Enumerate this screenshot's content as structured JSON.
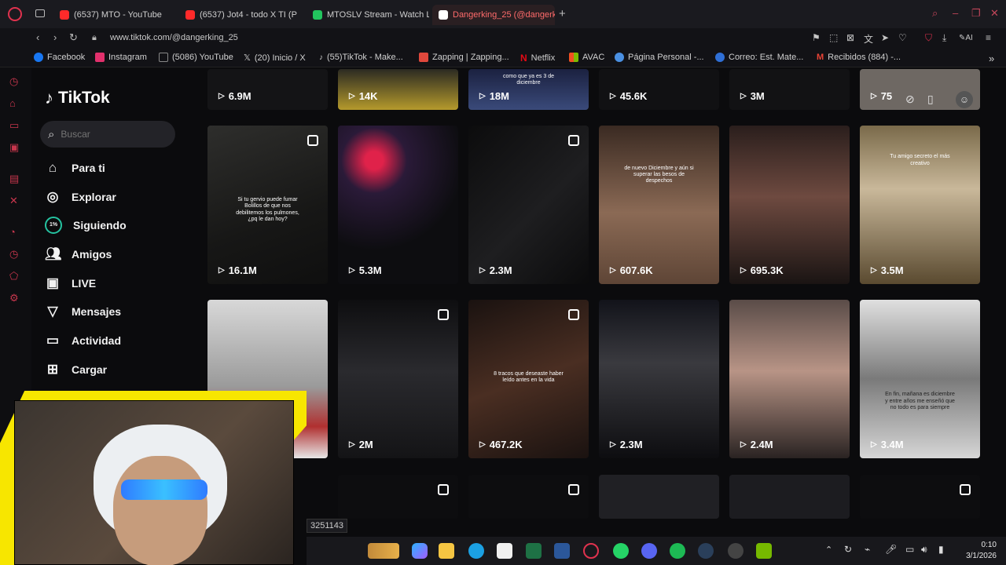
{
  "browser": {
    "tabs": [
      {
        "title": "(6537) MTO - YouTube",
        "favicon_color": "#ff2a2a",
        "active": false
      },
      {
        "title": "(6537) Jot4 - todo X TI (P",
        "favicon_color": "#ff2a2a",
        "active": false
      },
      {
        "title": "MTOSLV Stream - Watch L",
        "favicon_color": "#22c55e",
        "active": false
      },
      {
        "title": "Dangerking_25 (@dangerk",
        "favicon_color": "#ffffff",
        "active": true
      }
    ],
    "new_tab": "+",
    "url": "www.tiktok.com/@dangerking_25",
    "bookmarks": [
      {
        "label": "Facebook",
        "color": "#1877f2"
      },
      {
        "label": "Instagram",
        "color": "#e1306c"
      },
      {
        "label": "(5086) YouTube",
        "color": "#888888"
      },
      {
        "label": "(20) Inicio / X",
        "color": "#ffffff"
      },
      {
        "label": "(55)TikTok - Make...",
        "color": "#ffffff"
      },
      {
        "label": "Zapping | Zapping...",
        "color": "#e0483c"
      },
      {
        "label": "Netflix",
        "color": "#e50914"
      },
      {
        "label": "AVAC",
        "color": "#f4b400"
      },
      {
        "label": "Página Personal -...",
        "color": "#4a90e2"
      },
      {
        "label": "Correo: Est. Mate...",
        "color": "#2f6fd6"
      },
      {
        "label": "Recibidos (884) -...",
        "color": "#ea4335"
      }
    ]
  },
  "tiktok": {
    "logo": "TikTok",
    "search_placeholder": "Buscar",
    "nav": [
      {
        "label": "Para ti",
        "icon": "home-icon"
      },
      {
        "label": "Explorar",
        "icon": "compass-icon"
      },
      {
        "label": "Siguiendo",
        "icon": "following-icon"
      },
      {
        "label": "Amigos",
        "icon": "friends-icon"
      },
      {
        "label": "LIVE",
        "icon": "live-icon"
      },
      {
        "label": "Mensajes",
        "icon": "messages-icon"
      },
      {
        "label": "Actividad",
        "icon": "activity-icon"
      },
      {
        "label": "Cargar",
        "icon": "upload-icon"
      }
    ],
    "videos_row0": [
      "6.9M",
      "14K",
      "18M",
      "45.6K",
      "3M",
      "75"
    ],
    "row0_caption": "como que ya es 3 de diciembre",
    "videos_row1": [
      "16.1M",
      "5.3M",
      "2.3M",
      "607.6K",
      "695.3K",
      "3.5M"
    ],
    "videos_row2": [
      "",
      "2M",
      "467.2K",
      "2.3M",
      "2.4M",
      "3.4M"
    ],
    "captions_row1": [
      "Si tu gervio puede fumar Bolillos de que nos debilitemos los pulmones, ¿pq le dan hoy?",
      "",
      "",
      "de nuevo Diciembre y aún si superar las besos de despechos",
      "",
      "Tu amigo secreto el más creativo"
    ],
    "captions_row2": [
      "",
      "",
      "8 tracos que deseaste haber leído antes en la vida",
      "",
      "",
      "En fin, mañana es diciembre y entre años me enseñó que no todo es para siempre"
    ]
  },
  "overlay": {
    "status_url": "3251143"
  },
  "taskbar": {
    "time": "0:10",
    "date": "3/1/2026"
  }
}
